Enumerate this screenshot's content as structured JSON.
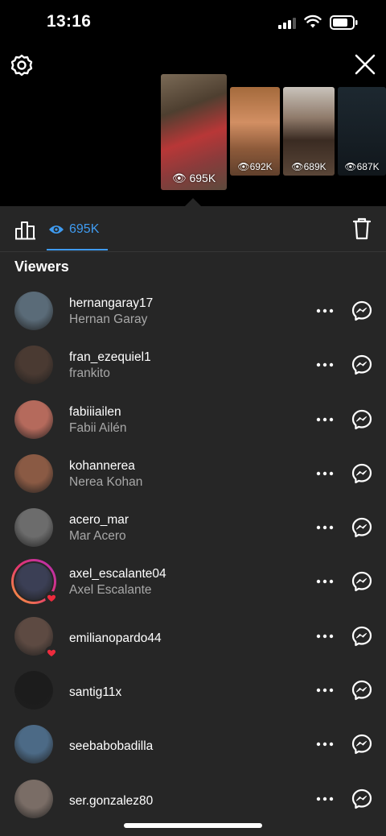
{
  "status_bar": {
    "time": "13:16"
  },
  "stories": [
    {
      "views": "695K"
    },
    {
      "views": "692K"
    },
    {
      "views": "689K"
    },
    {
      "views": "687K"
    }
  ],
  "tab": {
    "views_count": "695K"
  },
  "section_title": "Viewers",
  "colors": {
    "accent": "#3f9bf0",
    "background": "#262626",
    "muted": "#a8a8a8"
  },
  "viewers": [
    {
      "username": "hernangaray17",
      "fullname": "Hernan Garay",
      "avatar": "#5a6b78",
      "ring": false,
      "liked": false
    },
    {
      "username": "fran_ezequiel1",
      "fullname": "frankito",
      "avatar": "#4a3a32",
      "ring": false,
      "liked": false
    },
    {
      "username": "fabiiiailen",
      "fullname": "Fabii Ailén",
      "avatar": "#b56a5c",
      "ring": false,
      "liked": false
    },
    {
      "username": "kohannerea",
      "fullname": "Nerea Kohan",
      "avatar": "#8a5a44",
      "ring": false,
      "liked": false
    },
    {
      "username": "acero_mar",
      "fullname": "Mar Acero",
      "avatar": "#6c6c6c",
      "ring": false,
      "liked": false
    },
    {
      "username": "axel_escalante04",
      "fullname": "Axel Escalante",
      "avatar": "#3b3f55",
      "ring": true,
      "liked": true
    },
    {
      "username": "emilianopardo44",
      "fullname": "",
      "avatar": "#5d4a42",
      "ring": false,
      "liked": true
    },
    {
      "username": "santig11x",
      "fullname": "",
      "avatar": "#1c1c1c",
      "ring": false,
      "liked": false
    },
    {
      "username": "seebabobadilla",
      "fullname": "",
      "avatar": "#4c6a86",
      "ring": false,
      "liked": false
    },
    {
      "username": "ser.gonzalez80",
      "fullname": "",
      "avatar": "#7a6d66",
      "ring": false,
      "liked": false
    }
  ]
}
